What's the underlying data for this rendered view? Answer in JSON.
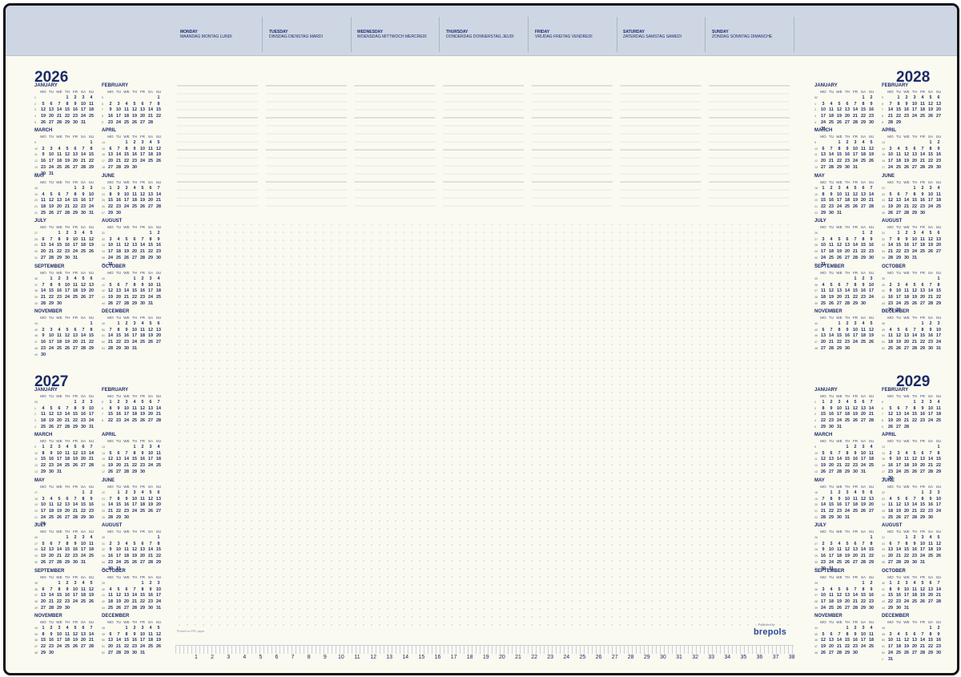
{
  "header": {
    "days": [
      {
        "name": "MONDAY",
        "translations": "MAANDAG MONTAG LUNDI"
      },
      {
        "name": "TUESDAY",
        "translations": "DINSDAG DIENSTAG MARDI"
      },
      {
        "name": "WEDNESDAY",
        "translations": "WOENSDAG MITTWOCH MERCREDI"
      },
      {
        "name": "THURSDAY",
        "translations": "DONDERDAG DONNERSTAG JEUDI"
      },
      {
        "name": "FRIDAY",
        "translations": "VRIJDAG FREITAG VENDREDI"
      },
      {
        "name": "SATURDAY",
        "translations": "ZATERDAG SAMSTAG SAMEDI"
      },
      {
        "name": "SUNDAY",
        "translations": "ZONDAG SONNTAG DIMANCHE"
      }
    ]
  },
  "calendar": {
    "weekday_headers": [
      "MO",
      "TU",
      "WE",
      "TH",
      "FR",
      "SA",
      "SU"
    ],
    "years": [
      {
        "year": "2026",
        "side": "left",
        "slot": "top"
      },
      {
        "year": "2027",
        "side": "left",
        "slot": "bottom"
      },
      {
        "year": "2028",
        "side": "right",
        "slot": "top"
      },
      {
        "year": "2029",
        "side": "right",
        "slot": "bottom"
      }
    ],
    "month_names": [
      "JANUARY",
      "FEBRUARY",
      "MARCH",
      "APRIL",
      "MAY",
      "JUNE",
      "JULY",
      "AUGUST",
      "SEPTEMBER",
      "OCTOBER",
      "NOVEMBER",
      "DECEMBER"
    ]
  },
  "footer": {
    "printed_note": "Printed on FSC paper",
    "published_by": "Published by",
    "brand": "brepols",
    "ruler_numbers": [
      "1",
      "2",
      "3",
      "4",
      "5",
      "6",
      "7",
      "8",
      "9",
      "10",
      "11",
      "12",
      "13",
      "14",
      "15",
      "16",
      "17",
      "18",
      "19",
      "20",
      "21",
      "22",
      "23",
      "24",
      "25",
      "26",
      "27",
      "28",
      "29",
      "30",
      "31",
      "32",
      "33",
      "34",
      "35",
      "36",
      "37",
      "38"
    ]
  },
  "colors": {
    "header_band": "#ced6e3",
    "ink": "#1b2a6b",
    "paper": "#fbfaf0",
    "brand": "#2a4a9a"
  }
}
